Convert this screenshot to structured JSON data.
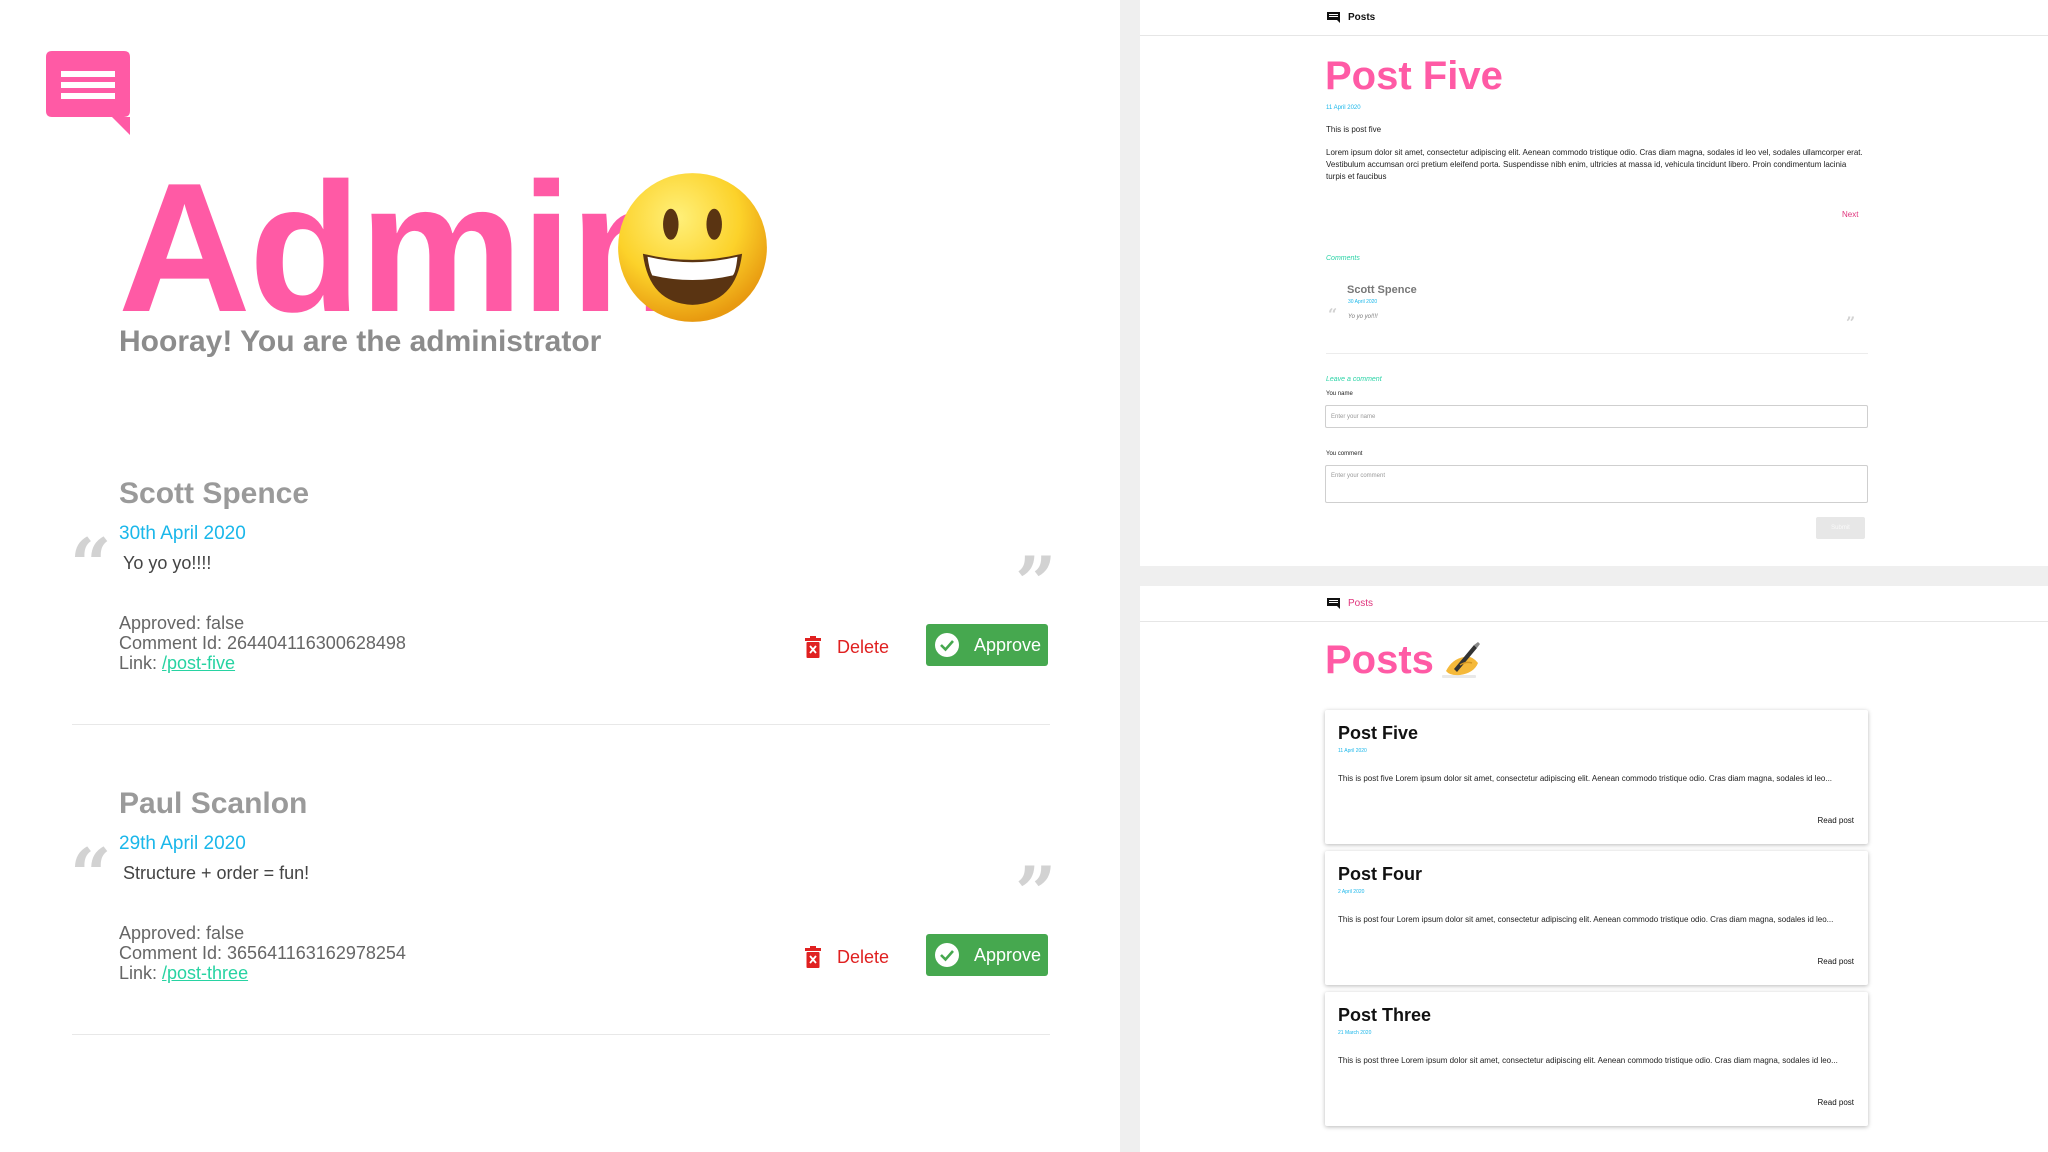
{
  "admin": {
    "title": "Admin",
    "subtitle": "Hooray! You are the administrator",
    "comments": [
      {
        "name": "Scott Spence",
        "date": "30th April 2020",
        "body": "Yo yo yo!!!!",
        "approved": "Approved: false",
        "comment_id": "Comment Id: 264404116300628498",
        "link_label": "Link: ",
        "link": "/post-five",
        "delete_label": "Delete",
        "approve_label": "Approve"
      },
      {
        "name": "Paul Scanlon",
        "date": "29th April 2020",
        "body": "Structure + order = fun!",
        "approved": "Approved: false",
        "comment_id": "Comment Id: 365641163162978254",
        "link_label": "Link: ",
        "link": "/post-three",
        "delete_label": "Delete",
        "approve_label": "Approve"
      }
    ]
  },
  "post_page": {
    "nav_label": "Posts",
    "title": "Post Five",
    "date": "11 April 2020",
    "lead": "This is post five",
    "lorem": "Lorem ipsum dolor sit amet, consectetur adipiscing elit. Aenean commodo tristique odio. Cras diam magna, sodales id leo vel, sodales ullamcorper erat. Vestibulum accumsan orci pretium eleifend porta. Suspendisse nibh enim, ultricies at massa id, vehicula tincidunt libero. Proin condimentum lacinia turpis et faucibus",
    "next": "Next",
    "comments_heading": "Comments",
    "comment": {
      "name": "Scott Spence",
      "date": "30 April 2020",
      "body": "Yo yo yo!!!!"
    },
    "leave_heading": "Leave a comment",
    "name_label": "You name",
    "name_placeholder": "Enter your name",
    "comment_label": "You comment",
    "comment_placeholder": "Enter your comment",
    "submit": "Submit"
  },
  "posts_page": {
    "nav_label": "Posts",
    "title": "Posts",
    "posts": [
      {
        "title": "Post Five",
        "date": "11 April 2020",
        "excerpt": "This is post five Lorem ipsum dolor sit amet, consectetur adipiscing elit. Aenean commodo tristique odio. Cras diam magna, sodales id leo...",
        "link": "Read post"
      },
      {
        "title": "Post Four",
        "date": "2 April 2020",
        "excerpt": "This is post four Lorem ipsum dolor sit amet, consectetur adipiscing elit. Aenean commodo tristique odio. Cras diam magna, sodales id leo...",
        "link": "Read post"
      },
      {
        "title": "Post Three",
        "date": "21 March 2020",
        "excerpt": "This is post three Lorem ipsum dolor sit amet, consectetur adipiscing elit. Aenean commodo tristique odio. Cras diam magna, sodales id leo...",
        "link": "Read post"
      }
    ]
  },
  "colors": {
    "brand_pink": "#ff5aa5",
    "date_blue": "#1ab7ea",
    "link_green": "#27d3a2",
    "approve_green": "#46a84f",
    "delete_red": "#e02020"
  },
  "icons": [
    "chat-logo-icon",
    "smiley-emoji-icon",
    "trash-icon",
    "check-circle-icon",
    "writing-hand-emoji-icon"
  ]
}
